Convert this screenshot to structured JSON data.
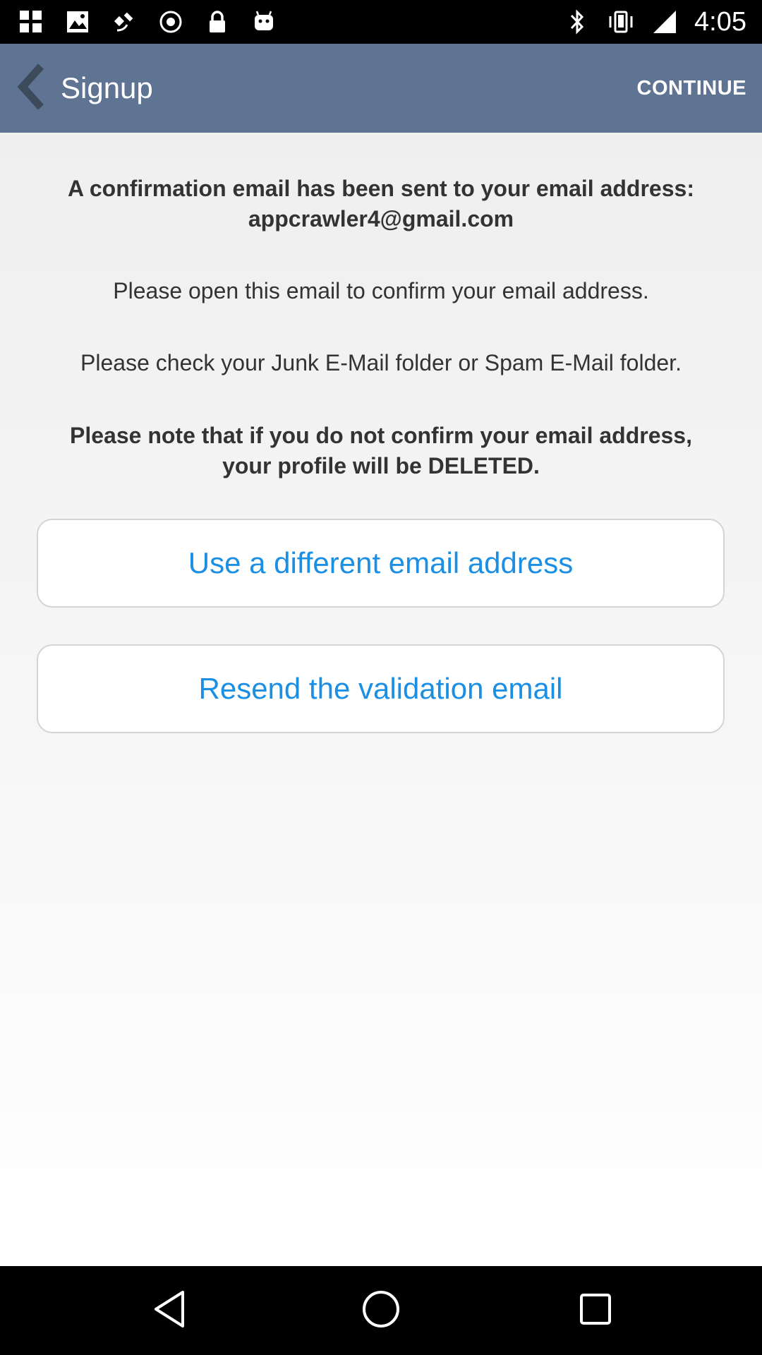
{
  "status_bar": {
    "time": "4:05",
    "icons": [
      "notification-icon",
      "photos-icon",
      "satellite-icon",
      "sync-icon",
      "lock-icon",
      "android-icon",
      "bluetooth-icon",
      "vibrate-icon",
      "signal-icon"
    ]
  },
  "app_bar": {
    "title": "Signup",
    "continue_label": "CONTINUE",
    "background_color": "#5f7493"
  },
  "messages": {
    "confirmation_line1": "A confirmation email has been sent to your email address:",
    "confirmation_email": "appcrawler4@gmail.com",
    "open_email": "Please open this email to confirm your email address.",
    "check_junk": "Please check your Junk E-Mail folder or Spam E-Mail folder.",
    "note_line1": "Please note that if you do not confirm your email address,",
    "note_line2": "your profile will be DELETED."
  },
  "buttons": {
    "different_email": "Use a different email address",
    "resend": "Resend the validation email",
    "text_color": "#1a8fe3"
  },
  "nav_bar": {
    "icons": [
      "back-icon",
      "home-icon",
      "recents-icon"
    ]
  }
}
